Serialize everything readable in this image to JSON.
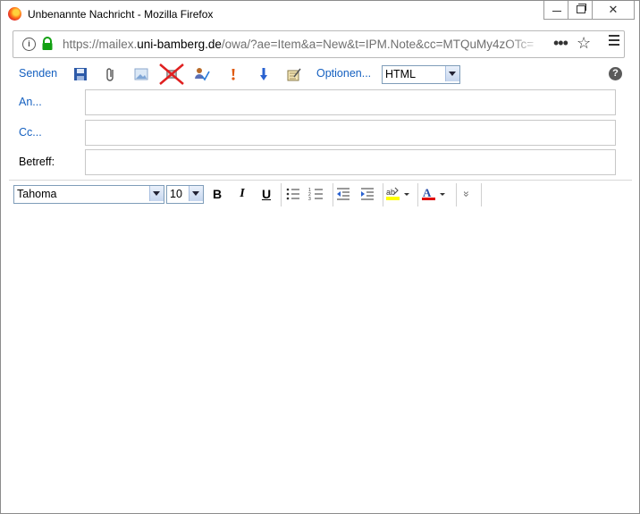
{
  "window": {
    "title": "Unbenannte Nachricht - Mozilla Firefox",
    "controls": {
      "minimize": "–",
      "maximize": "",
      "close": "✕"
    }
  },
  "urlbar": {
    "prefix": "https://mailex.",
    "host": "uni-bamberg.de",
    "path": "/owa/?ae=Item&a=New&t=IPM.Note&cc=MTQuMy4zOTc=",
    "more": "•••",
    "bookmark": "☆"
  },
  "toolbar": {
    "send_label": "Senden",
    "options_label": "Optionen...",
    "format_value": "HTML",
    "help": "?"
  },
  "fields": {
    "to_label": "An...",
    "to_value": "",
    "cc_label": "Cc...",
    "cc_value": "",
    "subject_label": "Betreff:",
    "subject_value": ""
  },
  "formatbar": {
    "font_value": "Tahoma",
    "size_value": "10",
    "bold": "B",
    "italic": "I",
    "underline": "U",
    "more": "»"
  },
  "colors": {
    "link": "#1560c0",
    "font_color_bar": "#e00000",
    "highlight_bar": "#ffff00"
  },
  "body": {
    "text": ""
  }
}
